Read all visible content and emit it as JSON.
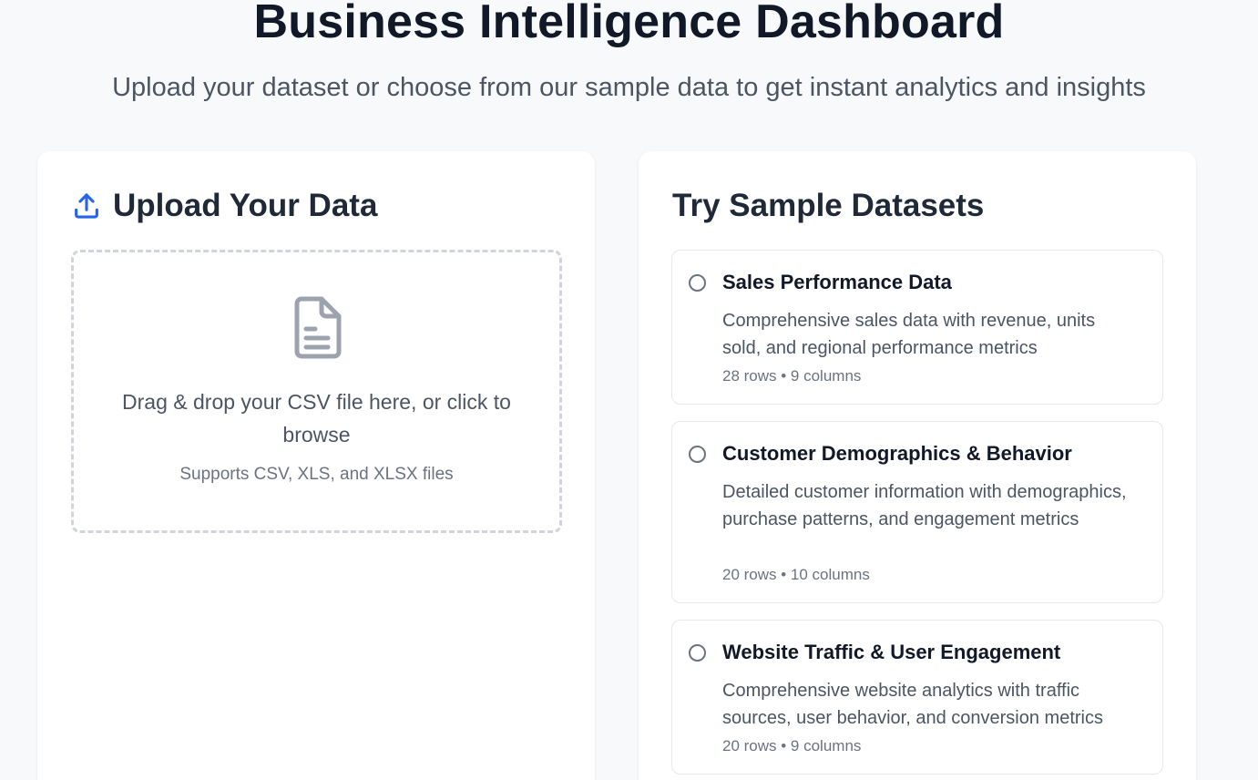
{
  "header": {
    "title": "Business Intelligence Dashboard",
    "subtitle": "Upload your dataset or choose from our sample data to get instant analytics and insights"
  },
  "upload": {
    "heading": "Upload Your Data",
    "icon": "upload-icon",
    "drop_text": "Drag & drop your CSV file here, or click to browse",
    "support_text": "Supports CSV, XLS, and XLSX files",
    "file_icon": "file-icon"
  },
  "samples": {
    "heading": "Try Sample Datasets",
    "datasets": [
      {
        "title": "Sales Performance Data",
        "description": "Comprehensive sales data with revenue, units sold, and regional performance metrics",
        "meta": "28 rows • 9 columns"
      },
      {
        "title": "Customer Demographics & Behavior",
        "description": "Detailed customer information with demographics, purchase patterns, and engagement metrics",
        "meta": "20 rows • 10 columns"
      },
      {
        "title": "Website Traffic & User Engagement",
        "description": "Comprehensive website analytics with traffic sources, user behavior, and conversion metrics",
        "meta": "20 rows • 9 columns"
      }
    ]
  },
  "colors": {
    "accent": "#2563eb",
    "background": "#f8f9fb",
    "card": "#ffffff"
  }
}
